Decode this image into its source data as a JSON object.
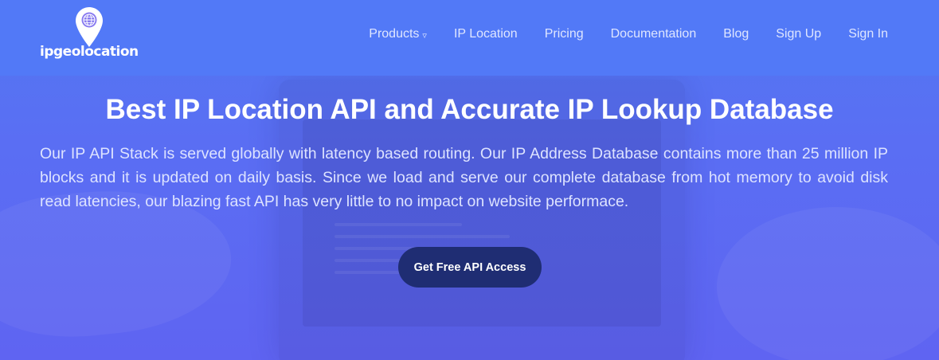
{
  "brand": {
    "name": "ipgeolocation",
    "logo_icon": "map-pin-globe-icon"
  },
  "nav": {
    "items": [
      {
        "label": "Products",
        "has_dropdown": true,
        "caret": "▿"
      },
      {
        "label": "IP Location"
      },
      {
        "label": "Pricing"
      },
      {
        "label": "Documentation"
      },
      {
        "label": "Blog"
      },
      {
        "label": "Sign Up"
      },
      {
        "label": "Sign In"
      }
    ]
  },
  "hero": {
    "title": "Best IP Location API and Accurate IP Lookup Database",
    "description": "Our IP API Stack is served globally with latency based routing. Our IP Address Database contains more than 25 million IP blocks and it is updated on daily basis. Since we load and serve our complete database from hot memory to avoid disk read latencies, our blazing fast API has very little to no impact on website performace.",
    "cta_label": "Get Free API Access"
  },
  "colors": {
    "header_bg": "#5279f7",
    "hero_bg": "#5a6ef3",
    "cta_bg": "#1f2d73",
    "text_primary": "#ffffff",
    "text_secondary": "#dde3ff"
  }
}
